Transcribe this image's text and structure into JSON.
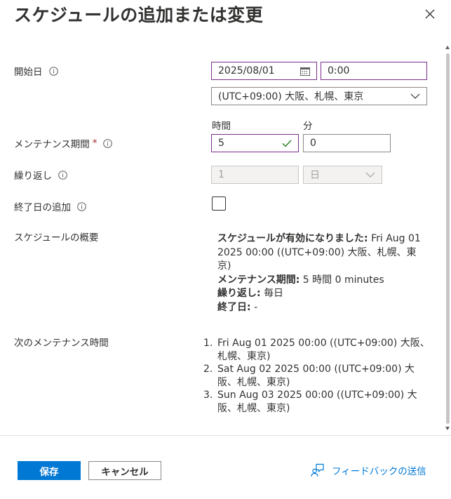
{
  "dialog": {
    "title": "スケジュールの追加または変更"
  },
  "start": {
    "label": "開始日",
    "date": "2025/08/01",
    "time": "0:00",
    "timezone": "(UTC+09:00) 大阪、札幌、東京"
  },
  "duration": {
    "label": "メンテナンス期間",
    "required_mark": "*",
    "hours_header": "時間",
    "minutes_header": "分",
    "hours": "5",
    "minutes": "0"
  },
  "repeat": {
    "label": "繰り返し",
    "count": "1",
    "unit": "日"
  },
  "end_date": {
    "label": "終了日の追加",
    "checked": false
  },
  "summary": {
    "label": "スケジュールの概要",
    "effective_label": "スケジュールが有効になりました:",
    "effective_value": "Fri Aug 01 2025 00:00 ((UTC+09:00) 大阪、札幌、東京)",
    "duration_label": "メンテナンス期間:",
    "duration_value": "5 時間 0 minutes",
    "repeat_label": "繰り返し:",
    "repeat_value": "毎日",
    "end_label": "終了日:",
    "end_value": "-"
  },
  "next": {
    "label": "次のメンテナンス時間",
    "items": [
      {
        "num": "1.",
        "text": "Fri Aug 01 2025 00:00 ((UTC+09:00) 大阪、札幌、東京)"
      },
      {
        "num": "2.",
        "text": "Sat Aug 02 2025 00:00 ((UTC+09:00) 大阪、札幌、東京)"
      },
      {
        "num": "3.",
        "text": "Sun Aug 03 2025 00:00 ((UTC+09:00) 大阪、札幌、東京)"
      }
    ]
  },
  "footer": {
    "save": "保存",
    "cancel": "キャンセル",
    "feedback": "フィードバックの送信"
  },
  "colors": {
    "primary": "#0078d4",
    "focus_border": "#7a2d8a",
    "valid_check": "#107c10",
    "required": "#a4262c"
  },
  "icons": [
    "close-icon",
    "info-icon",
    "calendar-icon",
    "check-icon",
    "chevron-down-icon",
    "feedback-icon"
  ]
}
